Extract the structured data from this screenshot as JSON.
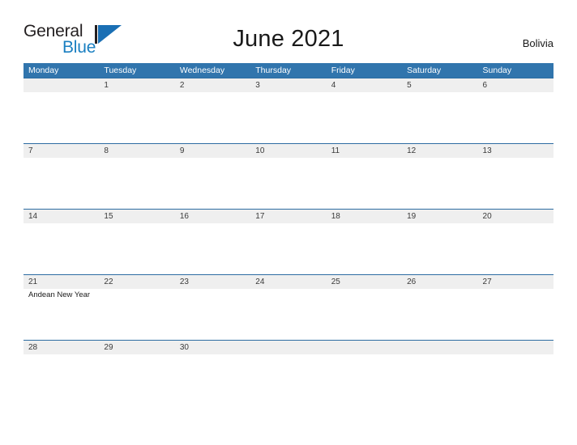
{
  "logo": {
    "word_one": "General",
    "word_two": "Blue",
    "mark_name": "general-blue-flag-logo"
  },
  "header": {
    "title": "June 2021",
    "country": "Bolivia"
  },
  "colors": {
    "header_blue": "#3175ad",
    "row_divider_blue": "#2d6ca2",
    "date_band_gray": "#efefef",
    "logo_blue": "#1a7fc1",
    "page_background": "#ffffff"
  },
  "calendar": {
    "weekdays": [
      "Monday",
      "Tuesday",
      "Wednesday",
      "Thursday",
      "Friday",
      "Saturday",
      "Sunday"
    ],
    "weeks": [
      {
        "days": [
          {
            "date": "",
            "event": ""
          },
          {
            "date": "1",
            "event": ""
          },
          {
            "date": "2",
            "event": ""
          },
          {
            "date": "3",
            "event": ""
          },
          {
            "date": "4",
            "event": ""
          },
          {
            "date": "5",
            "event": ""
          },
          {
            "date": "6",
            "event": ""
          }
        ]
      },
      {
        "days": [
          {
            "date": "7",
            "event": ""
          },
          {
            "date": "8",
            "event": ""
          },
          {
            "date": "9",
            "event": ""
          },
          {
            "date": "10",
            "event": ""
          },
          {
            "date": "11",
            "event": ""
          },
          {
            "date": "12",
            "event": ""
          },
          {
            "date": "13",
            "event": ""
          }
        ]
      },
      {
        "days": [
          {
            "date": "14",
            "event": ""
          },
          {
            "date": "15",
            "event": ""
          },
          {
            "date": "16",
            "event": ""
          },
          {
            "date": "17",
            "event": ""
          },
          {
            "date": "18",
            "event": ""
          },
          {
            "date": "19",
            "event": ""
          },
          {
            "date": "20",
            "event": ""
          }
        ]
      },
      {
        "days": [
          {
            "date": "21",
            "event": "Andean New Year"
          },
          {
            "date": "22",
            "event": ""
          },
          {
            "date": "23",
            "event": ""
          },
          {
            "date": "24",
            "event": ""
          },
          {
            "date": "25",
            "event": ""
          },
          {
            "date": "26",
            "event": ""
          },
          {
            "date": "27",
            "event": ""
          }
        ]
      },
      {
        "days": [
          {
            "date": "28",
            "event": ""
          },
          {
            "date": "29",
            "event": ""
          },
          {
            "date": "30",
            "event": ""
          },
          {
            "date": "",
            "event": ""
          },
          {
            "date": "",
            "event": ""
          },
          {
            "date": "",
            "event": ""
          },
          {
            "date": "",
            "event": ""
          }
        ]
      }
    ]
  }
}
